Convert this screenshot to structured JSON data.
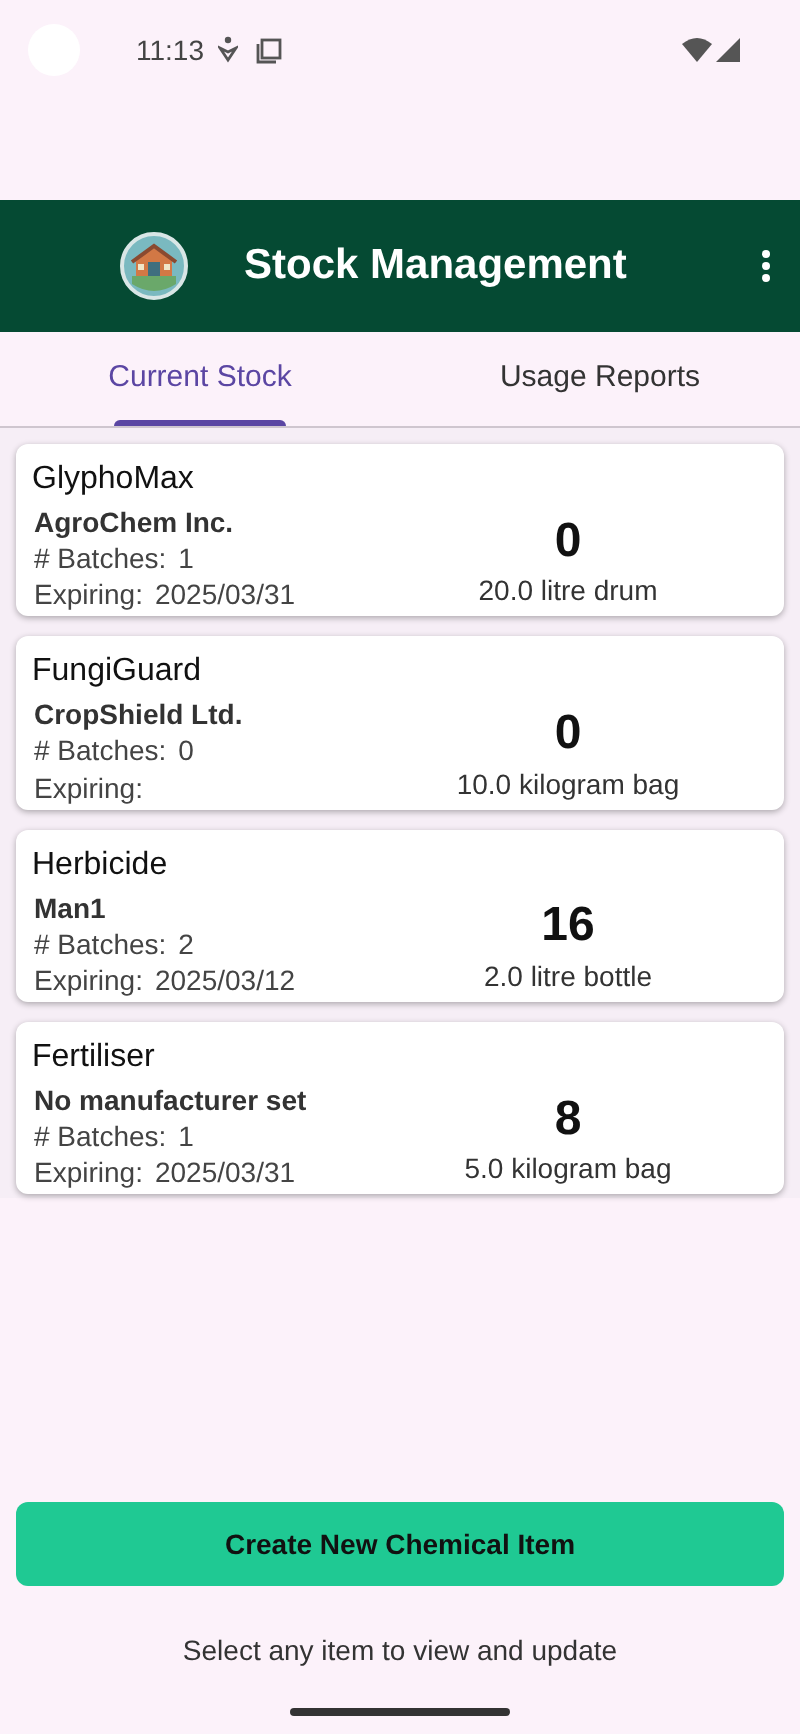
{
  "status_bar": {
    "time": "11:13"
  },
  "app_bar": {
    "title": "Stock Management"
  },
  "tabs": [
    {
      "label": "Current Stock",
      "selected": true
    },
    {
      "label": "Usage Reports",
      "selected": false
    }
  ],
  "items": [
    {
      "name": "GlyphoMax",
      "manufacturer": "AgroChem Inc.",
      "batches_label": "# Batches:",
      "batches": "1",
      "expiring_label": "Expiring:",
      "expiring": "2025/03/31",
      "quantity": "0",
      "unit": "20.0 litre drum"
    },
    {
      "name": "FungiGuard",
      "manufacturer": "CropShield Ltd.",
      "batches_label": "# Batches:",
      "batches": "0",
      "expiring_label": "Expiring:",
      "quantity": "0",
      "unit": "10.0 kilogram bag"
    },
    {
      "name": "Herbicide",
      "manufacturer": "Man1",
      "batches_label": "# Batches:",
      "batches": "2",
      "expiring_label": "Expiring:",
      "expiring": "2025/03/12",
      "quantity": "16",
      "unit": "2.0 litre bottle"
    },
    {
      "name": "Fertiliser",
      "manufacturer": "No manufacturer set",
      "batches_label": "# Batches:",
      "batches": "1",
      "expiring_label": "Expiring:",
      "expiring": "2025/03/31",
      "quantity": "8",
      "unit": "5.0 kilogram bag"
    }
  ],
  "create_button": "Create New Chemical Item",
  "hint": "Select any item to view and update"
}
